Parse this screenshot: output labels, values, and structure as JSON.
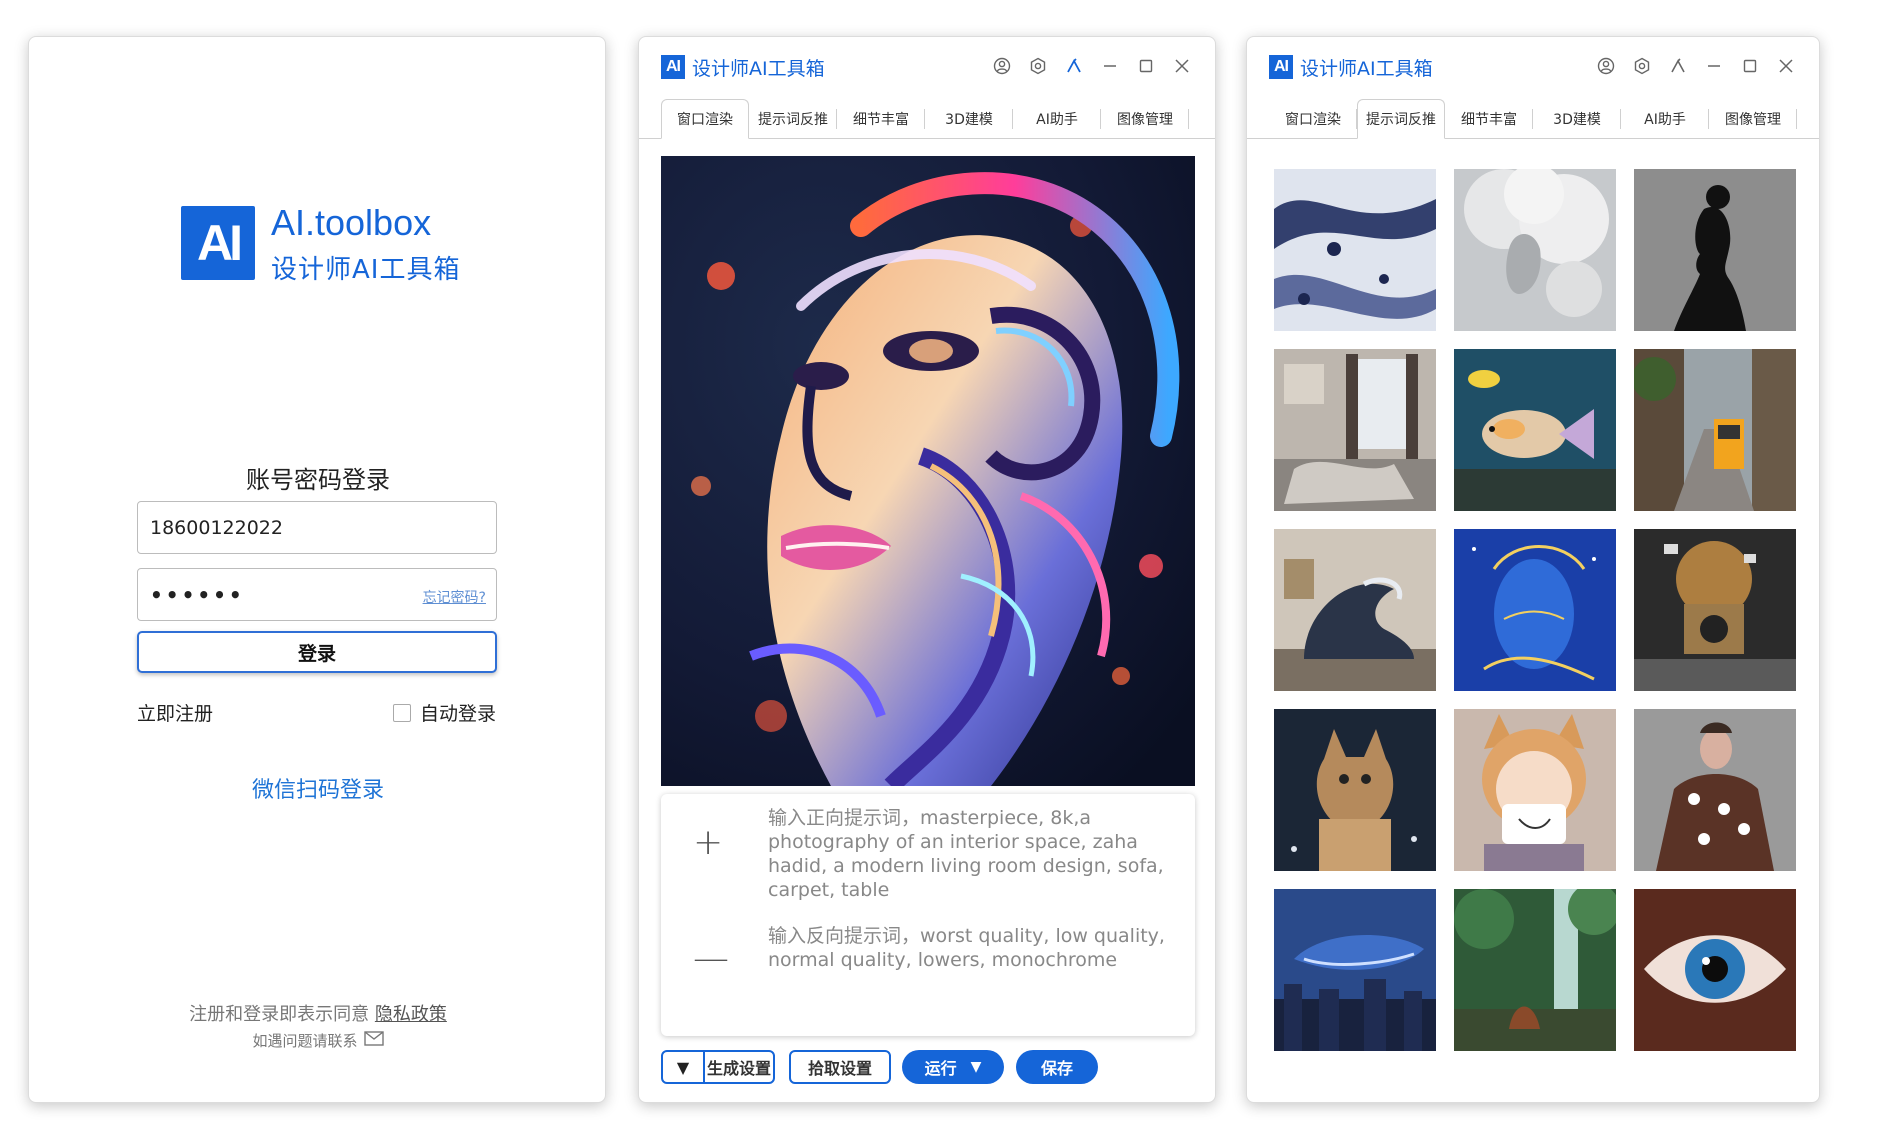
{
  "login": {
    "logo_mark": "AI",
    "brand_title": "AI.toolbox",
    "brand_subtitle": "设计师AI工具箱",
    "heading": "账号密码登录",
    "account_value": "18600122022",
    "password_mask": "••••••",
    "forgot_link": "忘记密码?",
    "login_button": "登录",
    "register_link": "立即注册",
    "auto_login_label": "自动登录",
    "wechat_login": "微信扫码登录",
    "agreement_text": "注册和登录即表示同意",
    "policy_link": "隐私政策",
    "contact_text": "如遇问题请联系"
  },
  "app": {
    "logo_mark": "AI",
    "title": "设计师AI工具箱",
    "tabs": [
      "窗口渲染",
      "提示词反推",
      "细节丰富",
      "3D建模",
      "AI助手",
      "图像管理"
    ]
  },
  "render_window": {
    "active_tab": "窗口渲染",
    "positive_prompt": "输入正向提示词，masterpiece, 8k,a photography of an interior space, zaha hadid, a modern living room design, sofa, carpet, table",
    "negative_prompt": "输入反向提示词，worst quality, low quality, normal quality, lowers, monochrome",
    "buttons": {
      "generate_settings": "生成设置",
      "pick_settings": "拾取设置",
      "run": "运行",
      "save": "保存"
    }
  },
  "gallery_window": {
    "active_tab": "提示词反推",
    "thumbnails": [
      "marble-swirl",
      "smoke-woman",
      "silhouette-woman",
      "messy-bedroom",
      "tropical-fish",
      "tram-street",
      "wave-sculpture",
      "gold-line-face",
      "exploding-camera",
      "lynx",
      "anime-cat-girl",
      "flower-dress-woman",
      "whale-city",
      "forest-waterfall",
      "eye-closeup"
    ]
  },
  "colors": {
    "brand": "#1565d8",
    "link": "#1f74d6"
  }
}
